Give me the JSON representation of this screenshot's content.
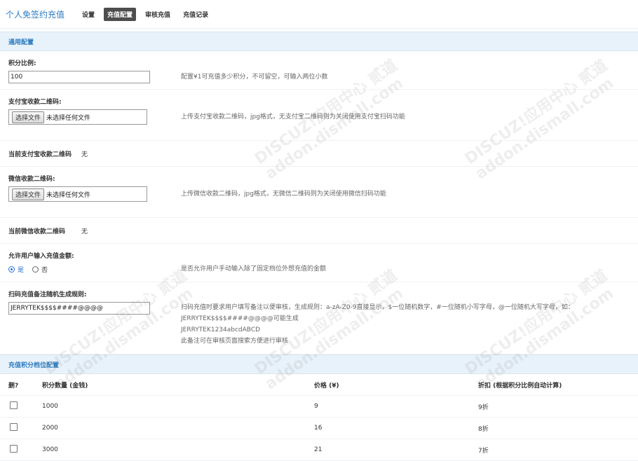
{
  "header": {
    "title": "个人免签约充值",
    "nav": [
      {
        "label": "设置",
        "active": false
      },
      {
        "label": "充值配置",
        "active": true
      },
      {
        "label": "审核充值",
        "active": false
      },
      {
        "label": "充值记录",
        "active": false
      }
    ]
  },
  "general": {
    "section_title": "通用配置",
    "ratio": {
      "label": "积分比例:",
      "value": "100",
      "tip": "配置¥1可充值多少积分，不可留空，可输入两位小数"
    },
    "alipay_qr": {
      "label": "支付宝收款二维码:",
      "button": "选择文件",
      "file_text": "未选择任何文件",
      "tip": "上传支付宝收款二维码，jpg格式，无支付宝二维码则为关闭使用支付宝扫码功能"
    },
    "current_alipay": {
      "label": "当前支付宝收款二维码",
      "value": "无"
    },
    "wechat_qr": {
      "label": "微信收款二维码:",
      "button": "选择文件",
      "file_text": "未选择任何文件",
      "tip": "上传微信收款二维码，jpg格式，无微信二维码则为关闭使用微信扫码功能"
    },
    "current_wechat": {
      "label": "当前微信收款二维码",
      "value": "无"
    },
    "custom_amount": {
      "label": "允许用户输入充值金额:",
      "yes": "是",
      "no": "否",
      "tip": "是否允许用户手动输入除了固定档位外想充值的金额"
    },
    "remark_rule": {
      "label": "扫码充值备注随机生成规则:",
      "value": "JERRYTEK$$$$####@@@@",
      "tip1": "扫码充值时要求用户填写备注以便审核，生成规则：a-zA-Z0-9直接显示，$一位随机数字，#一位随机小写字母，@一位随机大写字母，如：",
      "tip2": "JERRYTEK$$$$####@@@@可能生成",
      "tip3": "JERRYTEK1234abcdABCD",
      "tip4": "此备注可在审核页面搜索方便进行审核"
    }
  },
  "tiers": {
    "section_title": "充值积分档位配置",
    "columns": [
      "删?",
      "积分数量 (金钱)",
      "价格 (¥)",
      "折扣 (根据积分比例自动计算)"
    ],
    "rows": [
      {
        "points": "1000",
        "price": "9",
        "discount": "9折"
      },
      {
        "points": "2000",
        "price": "16",
        "discount": "8折"
      },
      {
        "points": "3000",
        "price": "21",
        "discount": "7折"
      }
    ]
  },
  "watermark": {
    "line1": "DISCUZ!应用中心",
    "line2": "addon.dismall.com",
    "mark": "贰道"
  }
}
